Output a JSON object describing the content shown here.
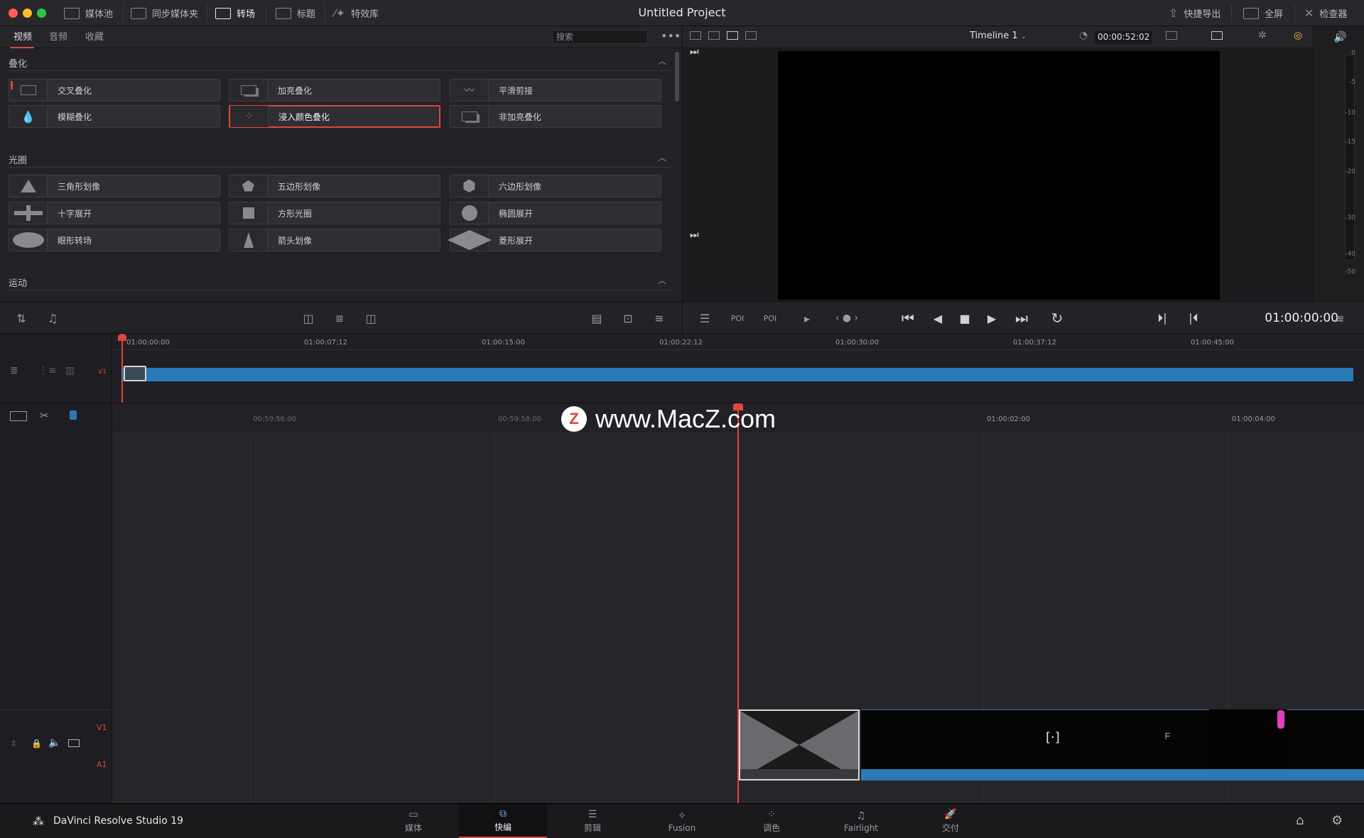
{
  "window": {
    "title": "Untitled Project"
  },
  "topbar": {
    "media_pool": "媒体池",
    "sync_bin": "同步媒体夹",
    "transitions": "转场",
    "titles": "标题",
    "effects": "特效库",
    "quick_export": "快捷导出",
    "fullscreen": "全屏",
    "inspector": "检查器"
  },
  "effects_panel": {
    "tabs": [
      "视频",
      "音频",
      "收藏"
    ],
    "search_placeholder": "搜索",
    "sections": {
      "dissolve": {
        "title": "叠化",
        "items": [
          "交叉叠化",
          "加亮叠化",
          "平滑剪接",
          "模糊叠化",
          "浸入颜色叠化",
          "非加亮叠化"
        ],
        "selected": "浸入颜色叠化"
      },
      "iris": {
        "title": "光圈",
        "items": [
          "三角形划像",
          "五边形划像",
          "六边形划像",
          "十字展开",
          "方形光圈",
          "椭圆展开",
          "眼形转场",
          "箭头划像",
          "菱形展开"
        ]
      },
      "motion": {
        "title": "运动"
      }
    }
  },
  "viewer": {
    "timeline_name": "Timeline 1",
    "duration": "00:00:52:02",
    "timecode": "01:00:00:00"
  },
  "audio_meter": {
    "ticks": [
      "0",
      "-5",
      "-10",
      "-15",
      "-20",
      "-30",
      "-40",
      "-50"
    ]
  },
  "upper_timeline": {
    "track_label": "V1",
    "ruler": [
      "01:00:00:00",
      "01:00:07:12",
      "01:00:15:00",
      "01:00:22:12",
      "01:00:30:00",
      "01:00:37:12",
      "01:00:45:00"
    ]
  },
  "lower_timeline": {
    "ruler": [
      "00:59:56:00",
      "00:59:58:00",
      "01:00:02:00",
      "01:00:04:00"
    ],
    "video_track_label": "V1",
    "audio_track_label": "A1"
  },
  "watermark": {
    "logo_letter": "Z",
    "text": "www.MacZ.com"
  },
  "app": {
    "name": "DaVinci Resolve Studio 19"
  },
  "pages": [
    "媒体",
    "快编",
    "剪辑",
    "Fusion",
    "调色",
    "Fairlight",
    "交付"
  ],
  "active_page": "快编",
  "colors": {
    "accent_red": "#e0463c",
    "clip_blue": "#2a7ab8"
  }
}
